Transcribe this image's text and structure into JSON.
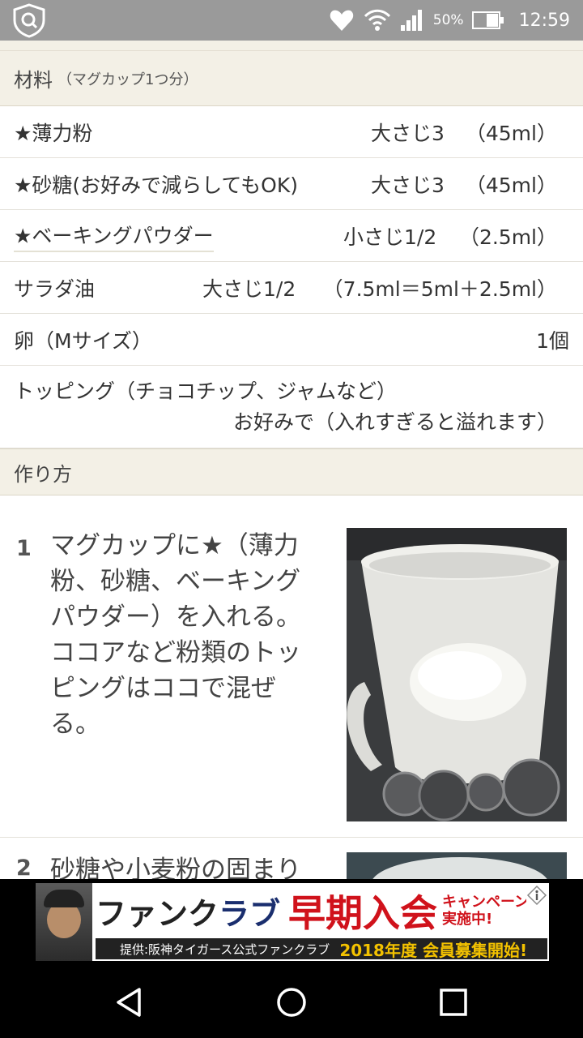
{
  "status_bar": {
    "battery_percent": "50%",
    "time": "12:59",
    "icons": [
      "shield-search-icon",
      "heart-notification-icon",
      "wifi-icon",
      "signal-icon",
      "battery-icon"
    ]
  },
  "ingredients": {
    "title": "材料",
    "servings": "（マグカップ1つ分）",
    "items": [
      {
        "name": "★薄力粉",
        "amount": "大さじ3",
        "ml": "（45ml）"
      },
      {
        "name": "★砂糖(お好みで減らしてもOK)",
        "amount": "大さじ3",
        "ml": "（45ml）"
      },
      {
        "name": "★ベーキングパウダー",
        "amount": "小さじ1/2",
        "ml": "（2.5ml）"
      },
      {
        "name": "サラダ油",
        "amount": "大さじ1/2",
        "ml": "（7.5ml＝5ml＋2.5ml）"
      },
      {
        "name": "卵（Mサイズ）",
        "amount": "1個"
      },
      {
        "name": "トッピング（チョコチップ、ジャムなど）",
        "amount": "お好みで（入れすぎると溢れます）"
      }
    ]
  },
  "steps": {
    "title": "作り方",
    "items": [
      {
        "number": "1",
        "text": "マグカップに★（薄力粉、砂糖、ベーキングパウダー）を入れる。ココアなど粉類のトッピングはココで混ぜる。"
      },
      {
        "number": "2",
        "text": "砂糖や小麦粉の固まり"
      }
    ]
  },
  "ad": {
    "fanclub_a": "ファンク",
    "fanclub_b": "ラブ",
    "headline": "早期入会",
    "campaign_1": "キャンペーン",
    "campaign_2": "実施中!",
    "sponsor": "提供:阪神タイガース公式ファンクラブ",
    "year_text": "2018年度 会員募集開始!"
  },
  "colors": {
    "status_bar": "#9a9a9a",
    "section_header": "#f3f0e6",
    "ad_red": "#d0121b",
    "nav_bar": "#000000"
  }
}
